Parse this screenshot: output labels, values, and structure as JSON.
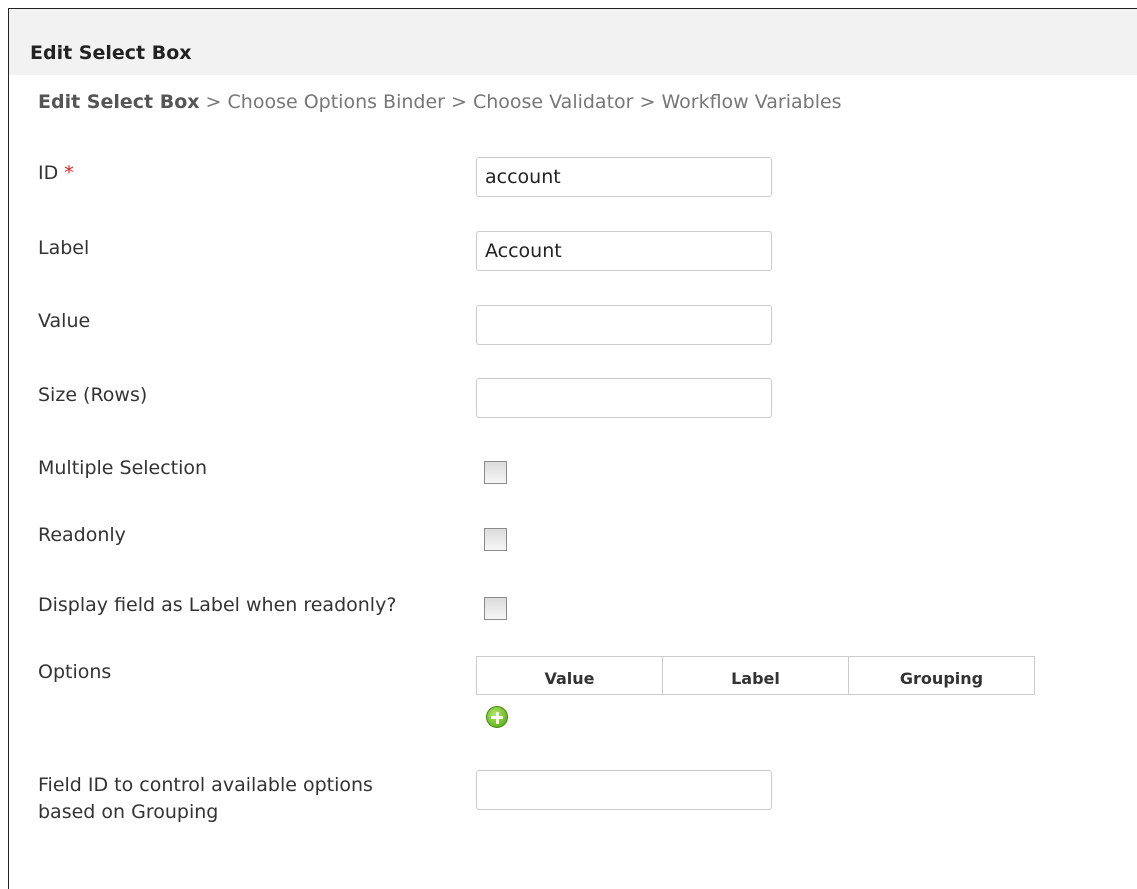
{
  "header": {
    "title": "Edit Select Box"
  },
  "breadcrumb": {
    "current": "Edit Select Box",
    "rest": " > Choose Options Binder > Choose Validator > Workflow Variables"
  },
  "fields": {
    "id": {
      "label": "ID",
      "required_mark": "*",
      "value": "account"
    },
    "label": {
      "label": "Label",
      "value": "Account"
    },
    "value": {
      "label": "Value",
      "value": ""
    },
    "size": {
      "label": "Size (Rows)",
      "value": ""
    },
    "multiple": {
      "label": "Multiple Selection",
      "checked": false
    },
    "readonly": {
      "label": "Readonly",
      "checked": false
    },
    "display_label": {
      "label": "Display field as Label when readonly?",
      "checked": false
    },
    "options": {
      "label": "Options",
      "columns": [
        "Value",
        "Label",
        "Grouping"
      ],
      "add_icon": "add-circle-icon"
    },
    "grouping_field": {
      "label_line1": "Field ID to control available options",
      "label_line2": "based on Grouping",
      "value": ""
    }
  },
  "colors": {
    "required": "#dd2222",
    "header_bg": "#f2f2f2",
    "add_green": "#79c231"
  }
}
